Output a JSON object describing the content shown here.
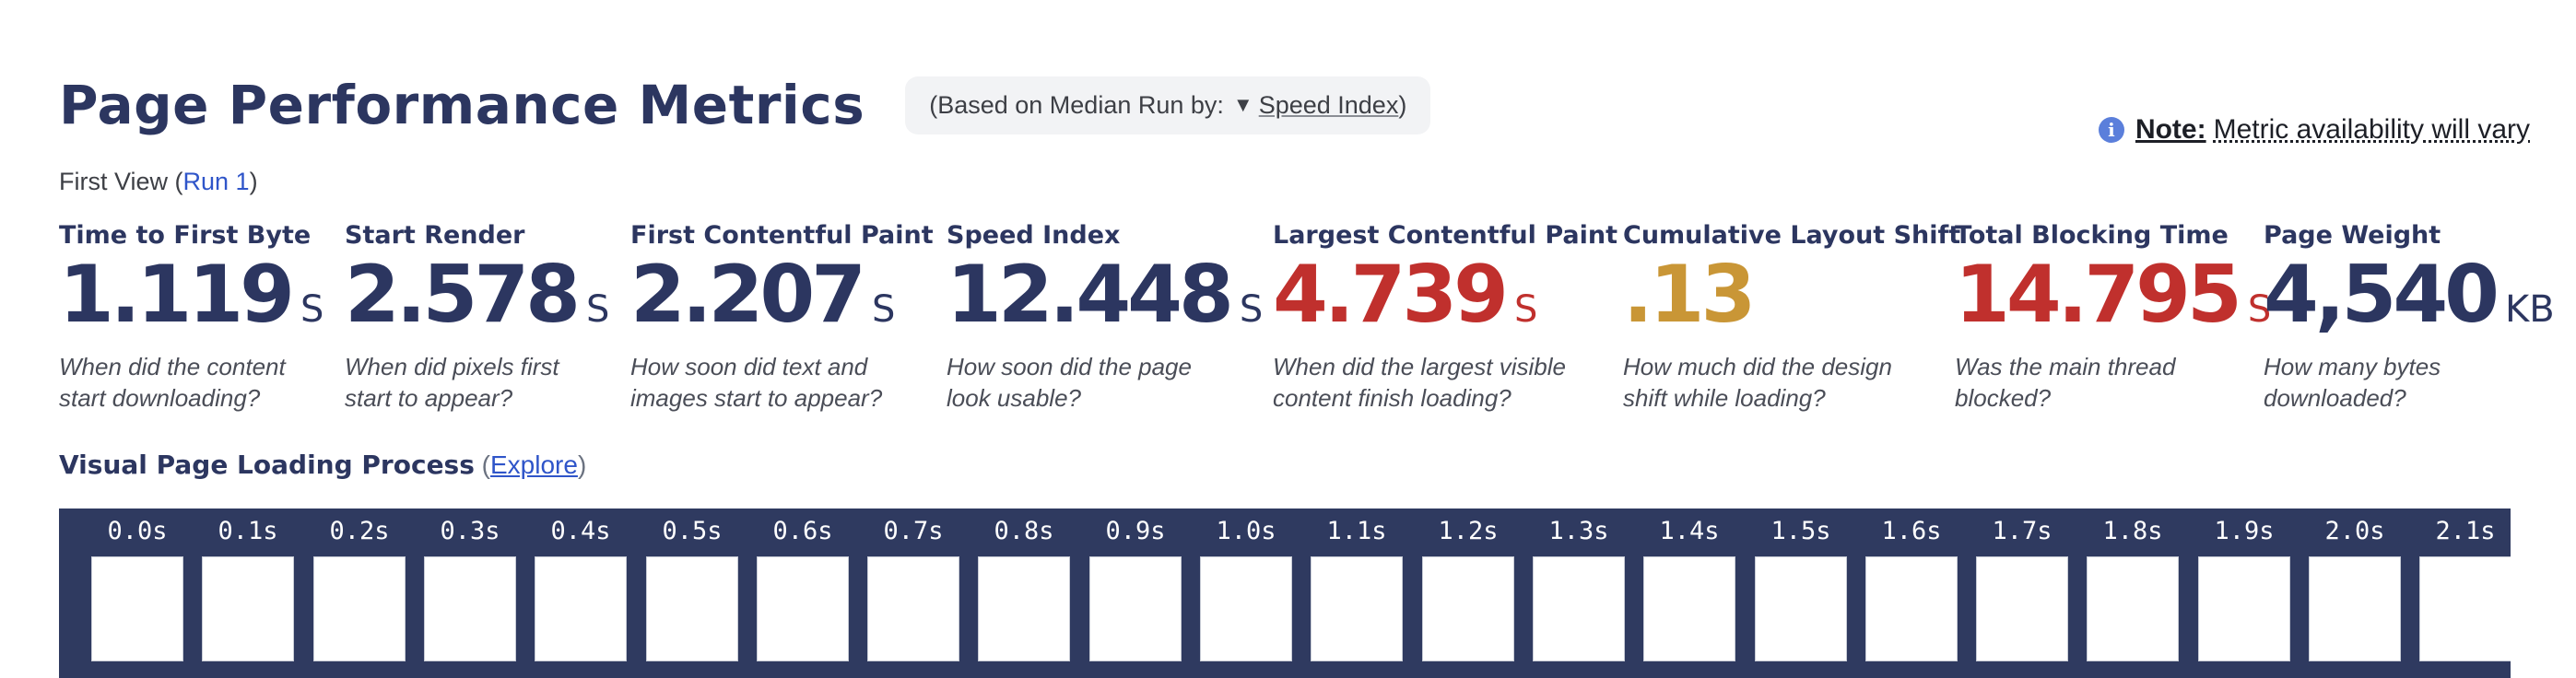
{
  "header": {
    "title": "Page Performance Metrics",
    "median_prefix": "(Based on Median Run by:",
    "median_arrow": "▼",
    "median_metric": "Speed Index",
    "median_suffix": ")"
  },
  "note": {
    "icon": "info-icon",
    "icon_glyph": "i",
    "label": "Note:",
    "text": "Metric availability will vary"
  },
  "first_view": {
    "prefix": "First View (",
    "run_link": "Run 1",
    "suffix": ")"
  },
  "metrics": [
    {
      "label": "Time to First Byte",
      "value": "1.119",
      "unit": "S",
      "desc_line1": "When did the content",
      "desc_line2": "start downloading?",
      "status": "good"
    },
    {
      "label": "Start Render",
      "value": "2.578",
      "unit": "S",
      "desc_line1": "When did pixels first",
      "desc_line2": "start to appear?",
      "status": "good"
    },
    {
      "label": "First Contentful Paint",
      "value": "2.207",
      "unit": "S",
      "desc_line1": "How soon did text and",
      "desc_line2": "images start to appear?",
      "status": "good"
    },
    {
      "label": "Speed Index",
      "value": "12.448",
      "unit": "S",
      "desc_line1": "How soon did the page",
      "desc_line2": "look usable?",
      "status": "good"
    },
    {
      "label": "Largest Contentful Paint",
      "value": "4.739",
      "unit": "S",
      "desc_line1": "When did the largest visible",
      "desc_line2": "content finish loading?",
      "status": "poor"
    },
    {
      "label": "Cumulative Layout Shift",
      "value": ".13",
      "unit": "",
      "desc_line1": "How much did the design",
      "desc_line2": "shift while loading?",
      "status": "warn"
    },
    {
      "label": "Total Blocking Time",
      "value": "14.795",
      "unit": "S",
      "desc_line1": "Was the main thread",
      "desc_line2": "blocked?",
      "status": "poor"
    },
    {
      "label": "Page Weight",
      "value": "4,540",
      "unit": "KB",
      "desc_line1": "How many bytes",
      "desc_line2": "downloaded?",
      "status": "good"
    }
  ],
  "colors": {
    "good": "#2c3660",
    "poor": "#c0302d",
    "warn": "#c99636",
    "filmstrip_bg": "#2f3a60",
    "link": "#2f55c9"
  },
  "visual_progress": {
    "label": "Visual Page Loading Process",
    "paren_open": "(",
    "explore_link": "Explore",
    "paren_close": ")"
  },
  "filmstrip": {
    "frames": [
      "0.0s",
      "0.1s",
      "0.2s",
      "0.3s",
      "0.4s",
      "0.5s",
      "0.6s",
      "0.7s",
      "0.8s",
      "0.9s",
      "1.0s",
      "1.1s",
      "1.2s",
      "1.3s",
      "1.4s",
      "1.5s",
      "1.6s",
      "1.7s",
      "1.8s",
      "1.9s",
      "2.0s",
      "2.1s"
    ]
  }
}
